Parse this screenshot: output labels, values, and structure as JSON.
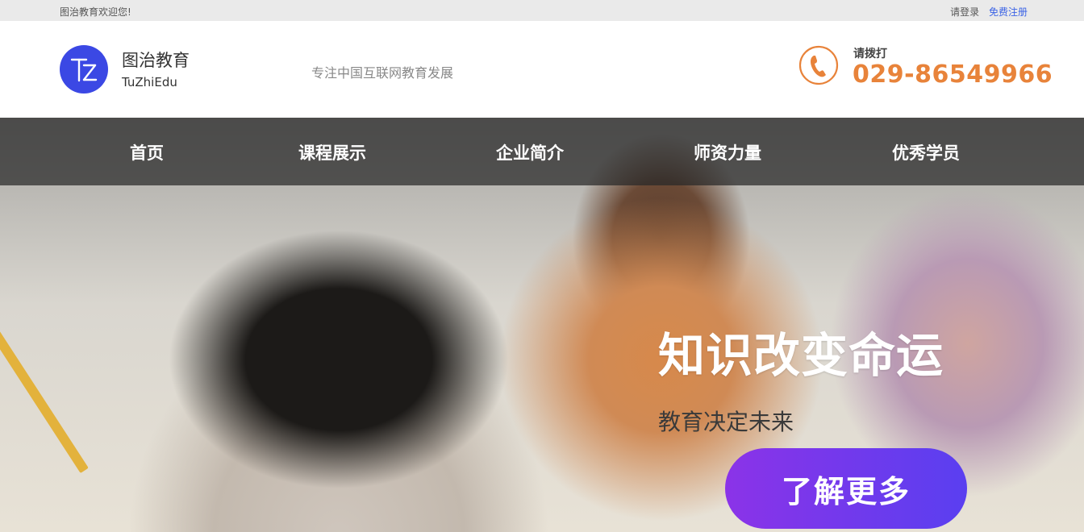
{
  "topbar": {
    "welcome": "图治教育欢迎您!",
    "login": "请登录",
    "register": "免费注册"
  },
  "header": {
    "logo_name": "图治教育",
    "logo_en": "TuZhiEdu",
    "slogan": "专注中国互联网教育发展",
    "phone_label": "请拨打",
    "phone_number": "029-86549966"
  },
  "nav": {
    "items": [
      {
        "label": "首页"
      },
      {
        "label": "课程展示"
      },
      {
        "label": "企业简介"
      },
      {
        "label": "师资力量"
      },
      {
        "label": "优秀学员"
      }
    ]
  },
  "hero": {
    "title": "知识改变命运",
    "subtitle": "教育决定未来",
    "cta": "了解更多"
  },
  "colors": {
    "brand": "#3b48e4",
    "phone_accent": "#e8833a",
    "cta_start": "#8b33e8",
    "cta_end": "#5a3ff0",
    "register_link": "#3b63e6"
  },
  "icons": {
    "logo": "tz-logo-icon",
    "phone": "phone-icon"
  }
}
